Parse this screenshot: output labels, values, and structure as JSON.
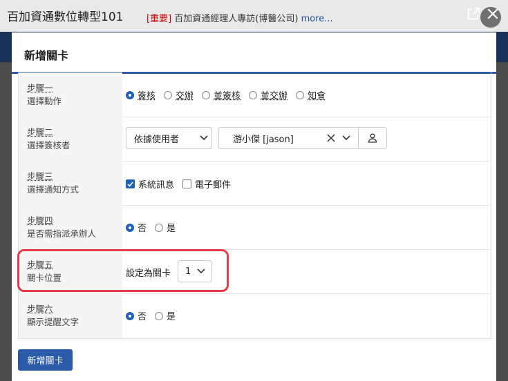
{
  "page": {
    "app_title": "百加資通數位轉型101",
    "notice_tag": "[重要]",
    "notice_text": " 百加資通經理人專訪(博醫公司)",
    "notice_more": " more..."
  },
  "modal": {
    "title": "新增關卡",
    "submit_label": "新增關卡",
    "steps": [
      {
        "step": "步驟一",
        "desc": "選擇動作",
        "options": [
          "簽核",
          "交辦",
          "並簽核",
          "並交辦",
          "知會"
        ],
        "selected": "簽核"
      },
      {
        "step": "步驟二",
        "desc": "選擇簽核者",
        "mode_select": "依據使用者",
        "user_select": "游小傑 [jason]"
      },
      {
        "step": "步驟三",
        "desc": "選擇通知方式",
        "checkboxes": [
          {
            "label": "系統訊息",
            "checked": true
          },
          {
            "label": "電子郵件",
            "checked": false
          }
        ]
      },
      {
        "step": "步驟四",
        "desc": "是否需指派承辦人",
        "options": [
          "否",
          "是"
        ],
        "selected": "否"
      },
      {
        "step": "步驟五",
        "desc": "關卡位置",
        "prefix": "設定為關卡",
        "position_select": "1"
      },
      {
        "step": "步驟六",
        "desc": "顯示提醒文字",
        "options": [
          "否",
          "是"
        ],
        "selected": "否"
      }
    ]
  },
  "colors": {
    "accent": "#2a5aa8",
    "highlight": "#e33b4a"
  }
}
